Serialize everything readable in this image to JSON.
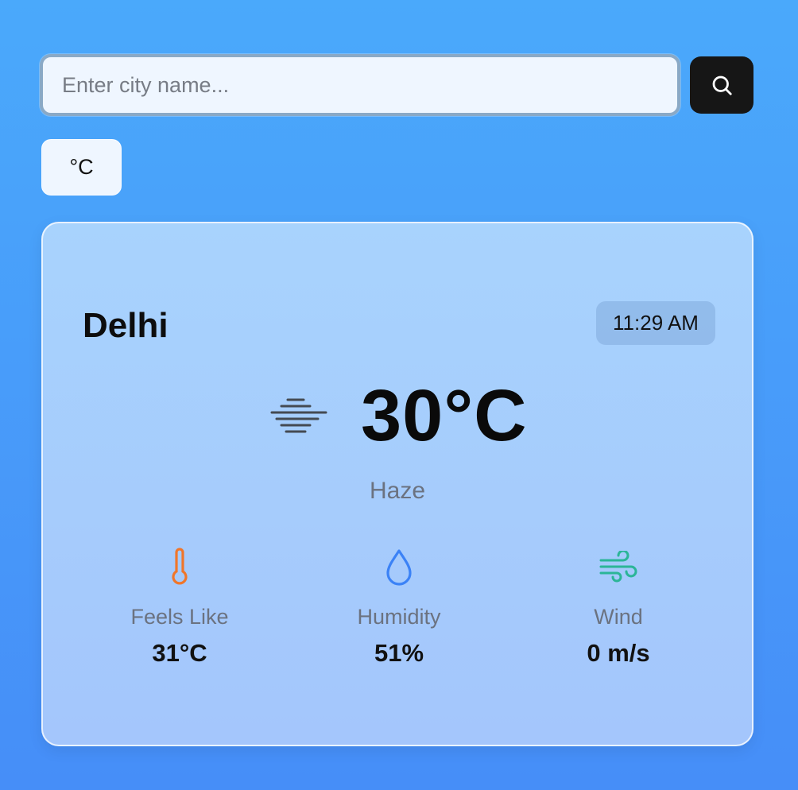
{
  "search": {
    "placeholder": "Enter city name...",
    "value": "",
    "button_icon": "search-icon"
  },
  "unit_toggle": {
    "label": "°C"
  },
  "weather": {
    "city": "Delhi",
    "time": "11:29 AM",
    "temperature": "30°C",
    "condition": "Haze",
    "condition_icon": "haze-icon",
    "stats": {
      "feels_like": {
        "label": "Feels Like",
        "value": "31°C",
        "icon": "thermometer-icon",
        "color": "#f0762a"
      },
      "humidity": {
        "label": "Humidity",
        "value": "51%",
        "icon": "droplet-icon",
        "color": "#3b82f6"
      },
      "wind": {
        "label": "Wind",
        "value": "0 m/s",
        "icon": "wind-icon",
        "color": "#2bb597"
      }
    }
  },
  "colors": {
    "background_top": "#4aa9fb",
    "background_bottom": "#468ef8",
    "search_button": "#161616"
  }
}
